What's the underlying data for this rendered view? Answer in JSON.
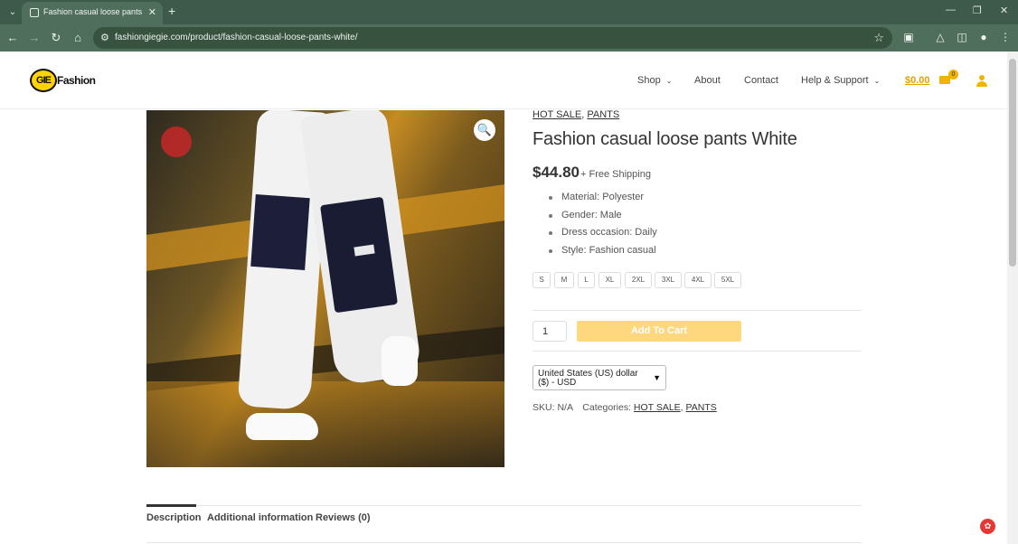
{
  "browser": {
    "tab_title": "Fashion casual loose pants White",
    "new_tab_symbol": "+",
    "url": "fashiongiegie.com/product/fashion-casual-loose-pants-white/"
  },
  "header": {
    "logo_mark": "GIE",
    "logo_text": "Fashion",
    "menu": {
      "shop": "Shop",
      "about": "About",
      "contact": "Contact",
      "help": "Help & Support"
    },
    "cart_total": "$0.00",
    "cart_count": "0"
  },
  "product": {
    "categories_top": {
      "cat1": "HOT SALE",
      "separator": ", ",
      "cat2": "PANTS"
    },
    "title": "Fashion casual loose pants White",
    "price": "$44.80",
    "shipping": "+ Free Shipping",
    "features": [
      "Material: Polyester",
      "Gender: Male",
      "Dress occasion: Daily",
      "Style: Fashion casual"
    ],
    "sizes": [
      "S",
      "M",
      "L",
      "XL",
      "2XL",
      "3XL",
      "4XL",
      "5XL"
    ],
    "quantity": "1",
    "add_to_cart": "Add To Cart",
    "currency": "United States (US) dollar ($) - USD",
    "sku_label": "SKU:",
    "sku_value": "N/A",
    "categories_label": "Categories:",
    "categories": {
      "cat1": "HOT SALE",
      "separator": ", ",
      "cat2": "PANTS"
    }
  },
  "tabs": {
    "description": "Description",
    "additional": "Additional information",
    "reviews": "Reviews (0)"
  },
  "icons": {
    "zoom": "magnifier-icon",
    "cart": "basket-icon",
    "account": "user-icon"
  },
  "colors": {
    "accent": "#f0b400",
    "add_to_cart_bg": "#ffd77f",
    "browser_frame": "#4f6e5c"
  }
}
